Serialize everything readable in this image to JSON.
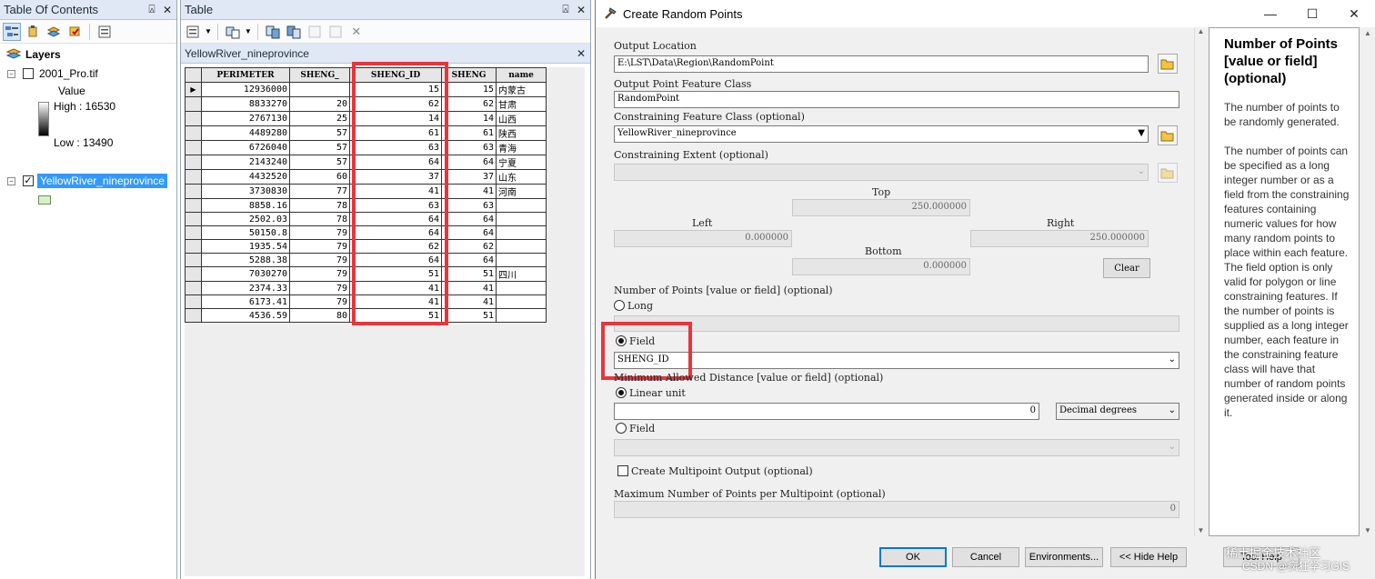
{
  "toc": {
    "title": "Table Of Contents",
    "pin": "⍓",
    "close": "✕",
    "layers_label": "Layers",
    "raster_layer": {
      "name": "2001_Pro.tif",
      "value_label": "Value",
      "high": "High : 16530",
      "low": "Low : 13490"
    },
    "vector_layer": {
      "name": "YellowRiver_nineprovince",
      "checked": true,
      "swatch_color": "#d9f0c8"
    }
  },
  "table": {
    "title": "Table",
    "tab_name": "YellowRiver_nineprovince",
    "columns": [
      "PERIMETER",
      "SHENG_",
      "SHENG_ID",
      "SHENG",
      "name"
    ],
    "rows": [
      [
        "12936000",
        "",
        "15",
        "15",
        "内蒙古"
      ],
      [
        "8833270",
        "20",
        "62",
        "62",
        "甘肃"
      ],
      [
        "2767130",
        "25",
        "14",
        "14",
        "山西"
      ],
      [
        "4489280",
        "57",
        "61",
        "61",
        "陕西"
      ],
      [
        "6726040",
        "57",
        "63",
        "63",
        "青海"
      ],
      [
        "2143240",
        "57",
        "64",
        "64",
        "宁夏"
      ],
      [
        "4432520",
        "60",
        "37",
        "37",
        "山东"
      ],
      [
        "3730830",
        "77",
        "41",
        "41",
        "河南"
      ],
      [
        "8858.16",
        "78",
        "63",
        "63",
        ""
      ],
      [
        "2502.03",
        "78",
        "64",
        "64",
        ""
      ],
      [
        "50150.8",
        "79",
        "64",
        "64",
        ""
      ],
      [
        "1935.54",
        "79",
        "62",
        "62",
        ""
      ],
      [
        "5288.38",
        "79",
        "64",
        "64",
        ""
      ],
      [
        "7030270",
        "79",
        "51",
        "51",
        "四川"
      ],
      [
        "2374.33",
        "79",
        "41",
        "41",
        ""
      ],
      [
        "6173.41",
        "79",
        "41",
        "41",
        ""
      ],
      [
        "4536.59",
        "80",
        "51",
        "51",
        ""
      ]
    ]
  },
  "dialog": {
    "title": "Create Random Points",
    "output_location_label": "Output Location",
    "output_location_value": "E:\\LST\\Data\\Region\\RandomPoint",
    "output_class_label": "Output Point Feature Class",
    "output_class_value": "RandomPoint",
    "constraining_class_label": "Constraining Feature Class (optional)",
    "constraining_class_value": "YellowRiver_nineprovince",
    "constraining_extent_label": "Constraining Extent (optional)",
    "extent": {
      "top_label": "Top",
      "top": "250.000000",
      "left_label": "Left",
      "left": "0.000000",
      "right_label": "Right",
      "right": "250.000000",
      "bottom_label": "Bottom",
      "bottom": "0.000000",
      "clear": "Clear"
    },
    "num_points_label": "Number of Points [value or field] (optional)",
    "long_label": "Long",
    "field_label": "Field",
    "field_value": "SHENG_ID",
    "min_dist_label": "Minimum Allowed Distance [value or field] (optional)",
    "linear_unit_label": "Linear unit",
    "linear_value": "0",
    "unit_value": "Decimal degrees",
    "field2_label": "Field",
    "multipoint_label": "Create Multipoint Output (optional)",
    "max_points_label": "Maximum Number of Points per Multipoint (optional)",
    "max_points_value": "0",
    "buttons": {
      "ok": "OK",
      "cancel": "Cancel",
      "env": "Environments...",
      "hide_help": "<< Hide Help",
      "tool_help": "Tool Help"
    }
  },
  "help": {
    "title": "Number of Points [value or field] (optional)",
    "p1": "The number of points to be randomly generated.",
    "p2": "The number of points can be specified as a long integer number or as a field from the constraining features containing numeric values for how many random points to place within each feature. The field option is only valid for polygon or line constraining features. If the number of points is supplied as a long integer number, each feature in the constraining feature class will have that number of random points generated inside or along it."
  },
  "watermark": {
    "line1": "稀土掘金技术社区",
    "line2": "CSDN @疯狂学习GIS"
  },
  "accent": {
    "highlight": "#e8353b",
    "selection": "#3399ff"
  }
}
